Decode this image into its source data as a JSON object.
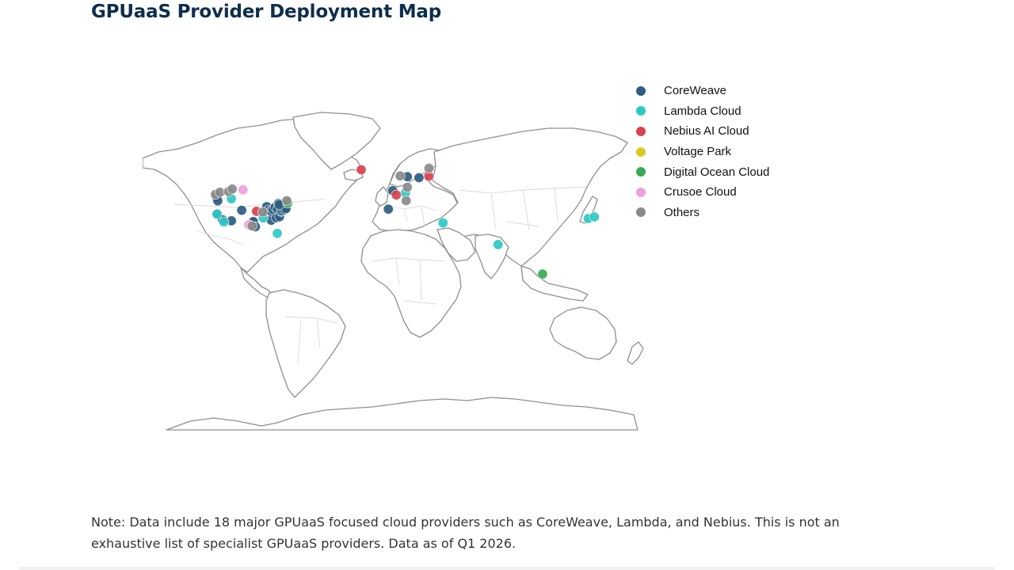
{
  "title": "GPUaaS Provider Deployment Map",
  "legend": [
    {
      "key": "coreweave",
      "label": "CoreWeave",
      "color": "#2d5d80"
    },
    {
      "key": "lambda",
      "label": "Lambda Cloud",
      "color": "#2ec9c4"
    },
    {
      "key": "nebius",
      "label": "Nebius AI Cloud",
      "color": "#d9434e"
    },
    {
      "key": "voltage",
      "label": "Voltage Park",
      "color": "#d6cc23"
    },
    {
      "key": "digitalocean",
      "label": "Digital Ocean Cloud",
      "color": "#3aaa55"
    },
    {
      "key": "crusoe",
      "label": "Crusoe Cloud",
      "color": "#ef9fdc"
    },
    {
      "key": "others",
      "label": "Others",
      "color": "#8a8a8a"
    }
  ],
  "points": [
    {
      "p": "coreweave",
      "lon": -122.3,
      "lat": 47.6
    },
    {
      "p": "coreweave",
      "lon": -121.5,
      "lat": 45.4
    },
    {
      "p": "coreweave",
      "lon": -121.9,
      "lat": 37.3
    },
    {
      "p": "coreweave",
      "lon": -118.2,
      "lat": 34.0
    },
    {
      "p": "coreweave",
      "lon": -112.0,
      "lat": 33.4
    },
    {
      "p": "coreweave",
      "lon": -104.9,
      "lat": 39.7
    },
    {
      "p": "coreweave",
      "lon": -97.3,
      "lat": 32.7
    },
    {
      "p": "coreweave",
      "lon": -96.8,
      "lat": 32.9
    },
    {
      "p": "coreweave",
      "lon": -95.4,
      "lat": 29.8
    },
    {
      "p": "coreweave",
      "lon": -87.6,
      "lat": 41.9
    },
    {
      "p": "coreweave",
      "lon": -86.2,
      "lat": 39.8
    },
    {
      "p": "coreweave",
      "lon": -84.4,
      "lat": 33.7
    },
    {
      "p": "coreweave",
      "lon": -84.5,
      "lat": 39.1
    },
    {
      "p": "coreweave",
      "lon": -83.0,
      "lat": 40.0
    },
    {
      "p": "coreweave",
      "lon": -81.7,
      "lat": 41.5
    },
    {
      "p": "coreweave",
      "lon": -80.8,
      "lat": 35.2
    },
    {
      "p": "coreweave",
      "lon": -80.0,
      "lat": 40.4
    },
    {
      "p": "coreweave",
      "lon": -78.6,
      "lat": 35.8
    },
    {
      "p": "coreweave",
      "lon": -77.5,
      "lat": 39.0
    },
    {
      "p": "coreweave",
      "lon": -76.6,
      "lat": 39.3
    },
    {
      "p": "coreweave",
      "lon": -75.2,
      "lat": 40.0
    },
    {
      "p": "coreweave",
      "lon": -74.1,
      "lat": 40.7
    },
    {
      "p": "coreweave",
      "lon": -79.4,
      "lat": 43.7
    },
    {
      "p": "coreweave",
      "lon": -0.1,
      "lat": 51.5
    },
    {
      "p": "coreweave",
      "lon": -3.2,
      "lat": 40.4
    },
    {
      "p": "coreweave",
      "lon": 10.0,
      "lat": 59.9
    },
    {
      "p": "coreweave",
      "lon": 18.1,
      "lat": 59.3
    },
    {
      "p": "lambda",
      "lon": -122.0,
      "lat": 37.5
    },
    {
      "p": "lambda",
      "lon": -112.1,
      "lat": 46.6
    },
    {
      "p": "lambda",
      "lon": -117.2,
      "lat": 32.7
    },
    {
      "p": "lambda",
      "lon": -90.0,
      "lat": 35.1
    },
    {
      "p": "lambda",
      "lon": -80.2,
      "lat": 25.8
    },
    {
      "p": "lambda",
      "lon": 8.7,
      "lat": 50.1
    },
    {
      "p": "lambda",
      "lon": 34.8,
      "lat": 32.1
    },
    {
      "p": "lambda",
      "lon": 72.9,
      "lat": 19.1
    },
    {
      "p": "lambda",
      "lon": 135.5,
      "lat": 34.7
    },
    {
      "p": "lambda",
      "lon": 139.7,
      "lat": 35.7
    },
    {
      "p": "nebius",
      "lon": -22.0,
      "lat": 64.1
    },
    {
      "p": "nebius",
      "lon": 24.9,
      "lat": 60.2
    },
    {
      "p": "nebius",
      "lon": 2.35,
      "lat": 48.9
    },
    {
      "p": "nebius",
      "lon": -94.6,
      "lat": 39.1
    },
    {
      "p": "coreweave",
      "lon": -78.9,
      "lat": 43.0
    },
    {
      "p": "digitalocean",
      "lon": 103.8,
      "lat": 1.35
    },
    {
      "p": "digitalocean",
      "lon": -73.0,
      "lat": 44.0
    },
    {
      "p": "crusoe",
      "lon": -104.0,
      "lat": 52.0
    },
    {
      "p": "crusoe",
      "lon": -100.0,
      "lat": 31.0
    },
    {
      "p": "others",
      "lon": -123.1,
      "lat": 49.3
    },
    {
      "p": "others",
      "lon": -120.0,
      "lat": 50.5
    },
    {
      "p": "others",
      "lon": -114.0,
      "lat": 51.0
    },
    {
      "p": "others",
      "lon": -111.5,
      "lat": 52.5
    },
    {
      "p": "others",
      "lon": -97.7,
      "lat": 30.3
    },
    {
      "p": "others",
      "lon": -90.2,
      "lat": 38.6
    },
    {
      "p": "others",
      "lon": -73.6,
      "lat": 45.5
    },
    {
      "p": "others",
      "lon": 25.0,
      "lat": 65.0
    },
    {
      "p": "others",
      "lon": 5.0,
      "lat": 60.4
    },
    {
      "p": "others",
      "lon": 9.2,
      "lat": 45.5
    },
    {
      "p": "others",
      "lon": 10.0,
      "lat": 53.5
    }
  ],
  "note": "Note: Data include 18 major GPUaaS focused cloud providers such as CoreWeave, Lambda, and Nebius. This is not an exhaustive list of specialist GPUaaS providers. Data as of Q1 2026."
}
